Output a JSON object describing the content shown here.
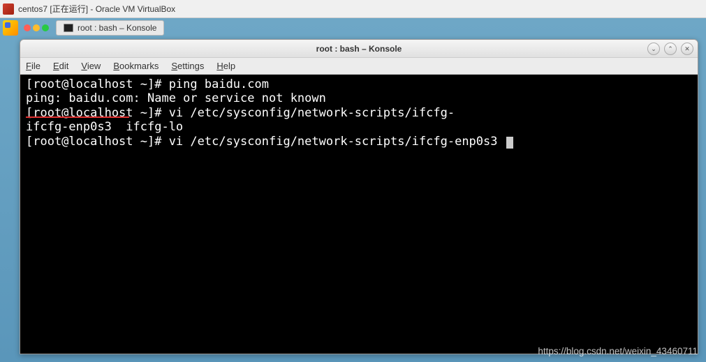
{
  "host": {
    "title": "centos7 [正在运行] - Oracle VM VirtualBox"
  },
  "taskbar": {
    "label": "root : bash – Konsole"
  },
  "konsole": {
    "title": "root : bash – Konsole",
    "minimize": "⌄",
    "maximize": "⌃",
    "close": "✕"
  },
  "menu": {
    "file": "File",
    "edit": "Edit",
    "view": "View",
    "bookmarks": "Bookmarks",
    "settings": "Settings",
    "help": "Help"
  },
  "terminal": {
    "lines": [
      "[root@localhost ~]# ping baidu.com",
      "ping: baidu.com: Name or service not known",
      "[root@localhost ~]# vi /etc/sysconfig/network-scripts/ifcfg-",
      "ifcfg-enp0s3  ifcfg-lo",
      "[root@localhost ~]# vi /etc/sysconfig/network-scripts/ifcfg-enp0s3 "
    ]
  },
  "watermark": "https://blog.csdn.net/weixin_43460711"
}
